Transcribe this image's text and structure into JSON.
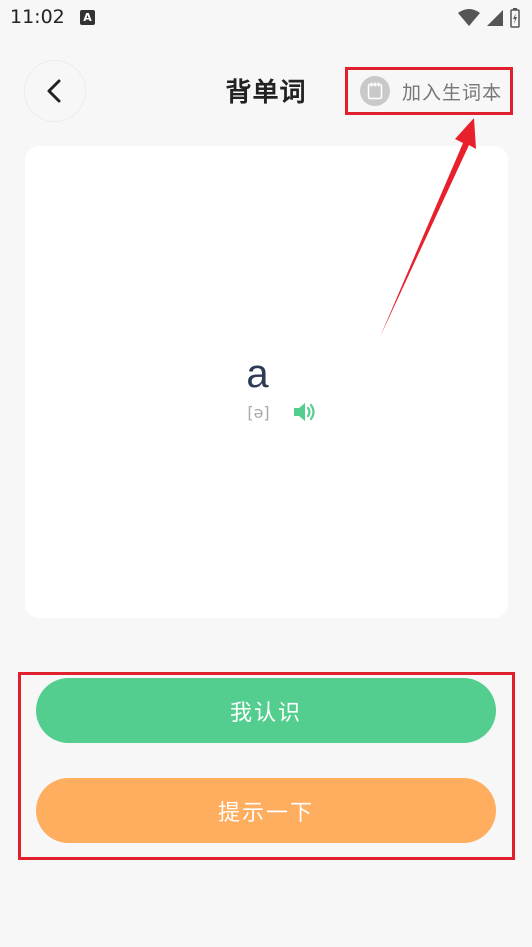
{
  "status_bar": {
    "time": "11:02",
    "notification_icon": "a-icon",
    "wifi_icon": "wifi-icon",
    "signal_icon": "signal-icon",
    "battery_icon": "battery-charging-icon"
  },
  "header": {
    "back_icon": "chevron-left-icon",
    "title": "背单词",
    "add_wordbook_icon": "notebook-icon",
    "add_wordbook_label": "加入生词本"
  },
  "card": {
    "word": "a",
    "phonetic": "[ə]",
    "speaker_icon": "speaker-icon"
  },
  "actions": {
    "know_label": "我认识",
    "hint_label": "提示一下"
  },
  "colors": {
    "accent_green": "#53ce8e",
    "accent_orange": "#ffad5e",
    "annotation_red": "#e0202c",
    "background": "#f7f7f7"
  }
}
